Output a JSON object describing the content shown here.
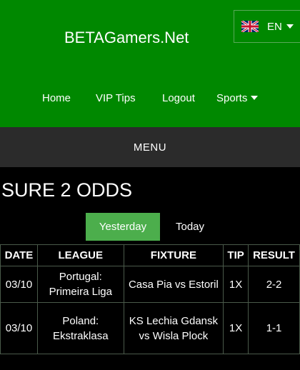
{
  "site": {
    "title": "BETAGamers.Net"
  },
  "language": {
    "code": "EN",
    "flag_icon": "uk-flag-icon"
  },
  "nav": {
    "items": [
      {
        "label": "Home"
      },
      {
        "label": "VIP Tips"
      },
      {
        "label": "Logout"
      },
      {
        "label": "Sports"
      }
    ]
  },
  "menu": {
    "label": "MENU"
  },
  "page": {
    "title": "SURE 2 ODDS"
  },
  "tabs": [
    {
      "label": "Yesterday",
      "active": true
    },
    {
      "label": "Today",
      "active": false
    }
  ],
  "table": {
    "headers": [
      "DATE",
      "LEAGUE",
      "FIXTURE",
      "TIP",
      "RESULT"
    ],
    "rows": [
      {
        "date": "03/10",
        "league": "Portugal: Primeira Liga",
        "fixture": "Casa Pia vs Estoril",
        "tip": "1X",
        "result": "2-2"
      },
      {
        "date": "03/10",
        "league": "Poland: Ekstraklasa",
        "fixture": "KS Lechia Gdansk vs Wisla Plock",
        "tip": "1X",
        "result": "1-1"
      }
    ]
  },
  "colors": {
    "header_green": "#008800",
    "active_tab": "#4cae4c",
    "menu_bar": "#2b2b2b",
    "background": "#000000"
  }
}
